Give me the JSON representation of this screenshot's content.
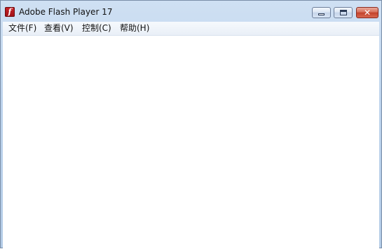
{
  "window": {
    "title": "Adobe Flash Player 17",
    "app_icon": "flash-icon",
    "app_icon_glyph": "f",
    "controls": {
      "minimize_icon": "minimize-icon",
      "maximize_icon": "maximize-icon",
      "close_icon": "close-icon",
      "close_glyph": "✕"
    }
  },
  "menubar": {
    "items": [
      {
        "label": "文件(F)"
      },
      {
        "label": "查看(V)"
      },
      {
        "label": "控制(C)"
      },
      {
        "label": "帮助(H)"
      }
    ]
  },
  "colors": {
    "titlebar": "#bcd3ec",
    "close_button": "#c3412a",
    "flash_icon": "#c8242a",
    "menubar": "#eef3f9",
    "client": "#ffffff"
  }
}
